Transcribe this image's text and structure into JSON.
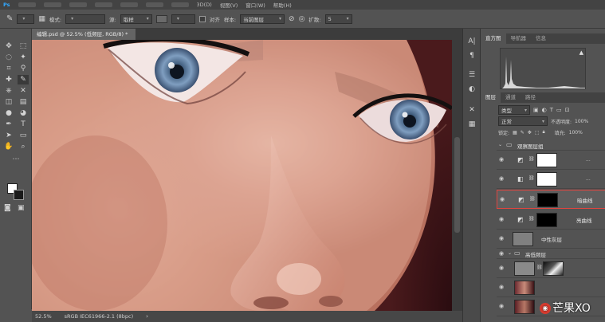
{
  "menubar": {
    "items": [
      "3D(D)",
      "视图(V)",
      "窗口(W)",
      "帮助(H)"
    ]
  },
  "options": {
    "mode_label": "模式:",
    "opacity_label": "源:",
    "sample_source": "取样",
    "aligned_label": "对齐",
    "sample_label": "样本:",
    "sample_value": "当前图层",
    "diffusion_label": "扩散:",
    "diffusion_value": "5"
  },
  "document": {
    "tab_title": "编辑.psd @ 52.5% (低频层, RGB/8) *",
    "zoom": "52.5%",
    "color_profile": "sRGB IEC61966-2.1 (8bpc)"
  },
  "panels": {
    "top_tabs": [
      "直方图",
      "导航器",
      "信息"
    ],
    "layer_tabs": [
      "图层",
      "通道",
      "路径"
    ],
    "filter_type": "类型",
    "blend_mode": "正常",
    "opacity_label": "不透明度:",
    "opacity_value": "100%",
    "lock_label": "锁定:",
    "fill_label": "填充:",
    "fill_value": "100%"
  },
  "layers": [
    {
      "name": "观察图层组",
      "kind": "group"
    },
    {
      "name": "",
      "kind": "adjustment-white"
    },
    {
      "name": "",
      "kind": "adjustment-white2"
    },
    {
      "name": "暗曲线",
      "kind": "curves-dark",
      "selected": true
    },
    {
      "name": "亮曲线",
      "kind": "curves-dark"
    },
    {
      "name": "中性灰层",
      "kind": "gray"
    },
    {
      "name": "高低频层",
      "kind": "group"
    },
    {
      "name": "",
      "kind": "smart"
    },
    {
      "name": "",
      "kind": "photo"
    }
  ],
  "watermark": {
    "text": "芒果XO"
  },
  "colors": {
    "accent_selected": "#e0453f",
    "panel_bg": "#535353"
  }
}
